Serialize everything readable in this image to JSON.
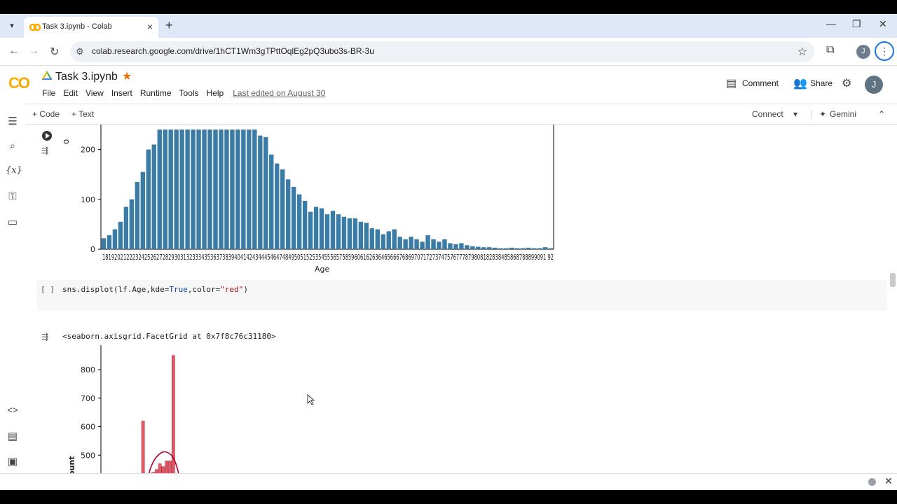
{
  "browser": {
    "tab_title": "Task 3.ipynb - Colab",
    "url": "colab.research.google.com/drive/1hCT1Wm3gTPttOqlEg2pQ3ubo3s-BR-3u",
    "profile_initial": "J"
  },
  "header": {
    "logo": "CO",
    "title": "Task 3.ipynb",
    "menu": [
      "File",
      "Edit",
      "View",
      "Insert",
      "Runtime",
      "Tools",
      "Help"
    ],
    "last_edited": "Last edited on August 30",
    "comment_label": "Comment",
    "share_label": "Share",
    "avatar_initial": "J"
  },
  "toolbar": {
    "code_label": "+ Code",
    "text_label": "+ Text",
    "connect_label": "Connect",
    "gemini_label": "Gemini"
  },
  "cells": {
    "code_bracket": "[ ]",
    "code_parts": [
      "sns.displot(lf.Age,kde=",
      "True",
      ",color=",
      "\"red\"",
      ")"
    ],
    "output_text": "<seaborn.axisgrid.FacetGrid at 0x7f8c76c31180>"
  },
  "colors": {
    "bar_blue": "#3a7ca5",
    "hist_red": "#e05a6a",
    "kde_red": "#b0002a",
    "accent": "#1a73e8"
  },
  "chart_data": [
    {
      "type": "bar",
      "xlabel": "Age",
      "ylabel": "",
      "ylabel_visible_fragment": "o",
      "ylim": [
        0,
        240
      ],
      "y_ticks": [
        0,
        100,
        200
      ],
      "categories": [
        18,
        19,
        20,
        21,
        22,
        23,
        24,
        25,
        26,
        27,
        28,
        29,
        30,
        31,
        32,
        33,
        34,
        35,
        36,
        37,
        38,
        39,
        40,
        41,
        42,
        43,
        44,
        45,
        46,
        47,
        48,
        49,
        50,
        51,
        52,
        53,
        54,
        55,
        56,
        57,
        58,
        59,
        60,
        61,
        62,
        63,
        64,
        65,
        66,
        67,
        68,
        69,
        70,
        71,
        72,
        73,
        74,
        75,
        76,
        77,
        78,
        79,
        80,
        81,
        82,
        83,
        84,
        85,
        86,
        87,
        88,
        89,
        90,
        91,
        92
      ],
      "x_tick_text": "1819202122232425262728293031323334353637383940414243444546474849505152535455565758596061626364656667686970717273747576777879808182838485868788899091 92",
      "values": [
        22,
        28,
        40,
        55,
        85,
        100,
        135,
        155,
        200,
        210,
        240,
        240,
        240,
        240,
        240,
        240,
        240,
        240,
        240,
        240,
        240,
        240,
        240,
        240,
        240,
        240,
        240,
        240,
        228,
        225,
        190,
        172,
        160,
        140,
        125,
        110,
        97,
        75,
        85,
        82,
        70,
        77,
        70,
        65,
        62,
        62,
        55,
        53,
        42,
        40,
        30,
        36,
        40,
        25,
        20,
        25,
        20,
        15,
        28,
        20,
        15,
        20,
        12,
        10,
        12,
        8,
        6,
        5,
        4,
        4,
        3,
        2,
        2,
        3,
        2,
        2,
        3,
        2,
        2,
        4,
        2
      ]
    },
    {
      "type": "bar",
      "ylabel": "Count",
      "ylim": [
        400,
        860
      ],
      "y_ticks": [
        400,
        500,
        600,
        700,
        800
      ],
      "values": [
        620,
        400,
        420,
        440,
        450,
        470,
        460,
        480,
        480,
        850
      ],
      "kde": "True"
    }
  ]
}
